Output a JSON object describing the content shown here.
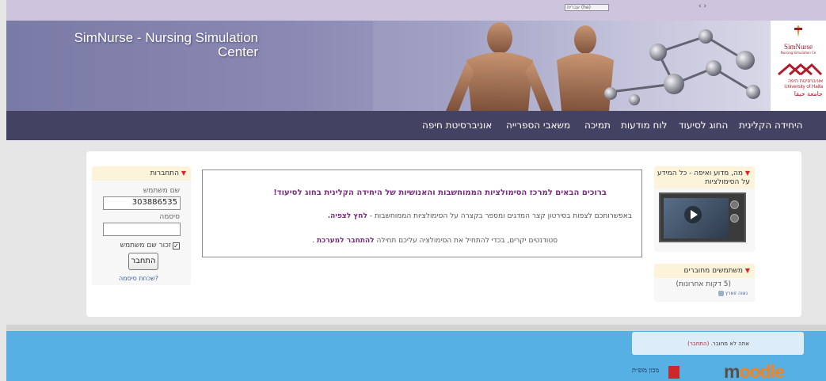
{
  "topbar": {
    "language_select": "עברית (he)",
    "misc": "‹ ›"
  },
  "header": {
    "site_title": "SimNurse - Nursing Simulation Center"
  },
  "logos": {
    "simnurse_name": "SimNurse",
    "simnurse_sub": "Nursing Simulation Ce",
    "haifa_he": "אוניברסיטת חיפה",
    "haifa_en": "University of Haifa",
    "haifa_ar": "جامعة حيفا"
  },
  "nav": {
    "items": [
      "היחידה הקלינית",
      "החוג לסיעוד",
      "לוח מודעות",
      "תמיכה",
      "משאבי הספרייה",
      "אוניברסיטת חיפה"
    ]
  },
  "login": {
    "title": "התחברות",
    "username_label": "שם משתמש",
    "username_value": "303886535",
    "password_label": "סיסמה",
    "password_value": "",
    "remember_label": "זכור שם משתמש",
    "remember_checked": true,
    "button_label": "התחבר",
    "forgot_link": "שכחת סיסמה?"
  },
  "welcome": {
    "title": "ברוכים הבאים למרכז הסימולציות הממוחשבות והאנושיות של היחידה הקלינית בחוג לסיעוד!",
    "line2_text": "באפשרותכם לצפות בסירטון קצר המדגים ומספר בקצרה על הסימולציות הממוחשבות -",
    "line2_link": "לחץ לצפיה.",
    "line3_text": "סטודנטים יקרים, בכדי להתחיל את הסימולציה עליכם תחילה",
    "line3_link": "להתחבר למערכת",
    "line3_end": "."
  },
  "video_block": {
    "title": "מה, מדוע ואיפה - כל המידע על הסימולציות"
  },
  "online_block": {
    "title": "משתמשים מחוברים",
    "period": "(5 דקות אחרונות)",
    "user": "נאוה זוארץ"
  },
  "footer": {
    "login_status": "אתה לא מחובר.",
    "login_link": "(התחבר)",
    "partner_text": "מכון מופ״ת",
    "moodle_m": "m",
    "moodle_rest": "oodle"
  },
  "colors": {
    "nav_bg": "#434262",
    "footer_bg": "#56b0e3",
    "accent_purple": "#7a2c80",
    "caret_red": "#d3262b"
  }
}
